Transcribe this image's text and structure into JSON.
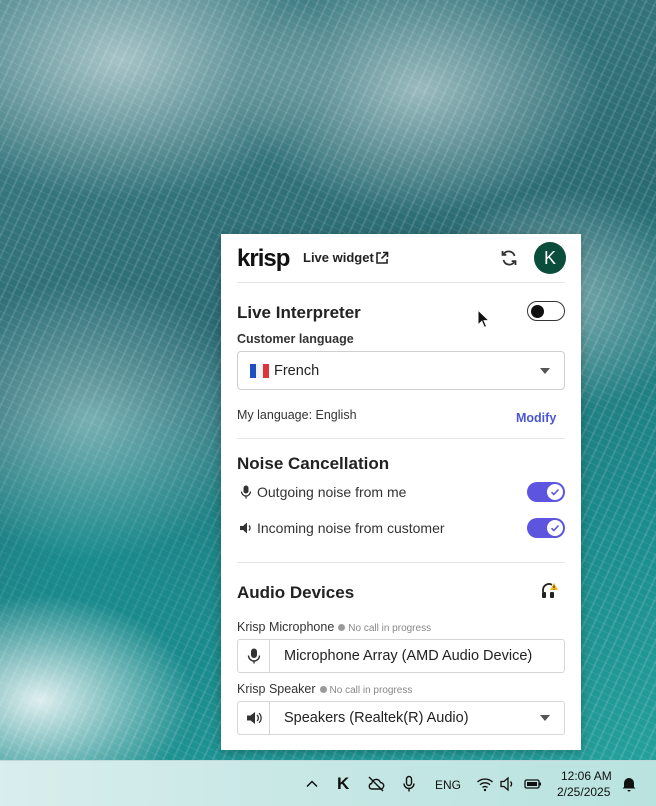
{
  "header": {
    "logo": "krisp",
    "live_widget_label": "Live widget",
    "avatar_initial": "K"
  },
  "interpreter": {
    "title": "Live Interpreter",
    "enabled": false,
    "customer_language_label": "Customer language",
    "customer_language_value": "French",
    "my_language_text": "My language: English",
    "modify_label": "Modify"
  },
  "noise": {
    "title": "Noise Cancellation",
    "outgoing_label": "Outgoing noise from me",
    "outgoing_enabled": true,
    "incoming_label": "Incoming noise from customer",
    "incoming_enabled": true
  },
  "audio": {
    "title": "Audio Devices",
    "mic_label": "Krisp Microphone",
    "mic_status": "No call in progress",
    "mic_device": "Microphone Array (AMD Audio Device)",
    "speaker_label": "Krisp Speaker",
    "speaker_status": "No call in progress",
    "speaker_device": "Speakers (Realtek(R) Audio)"
  },
  "taskbar": {
    "language": "ENG",
    "time": "12:06 AM",
    "date": "2/25/2025",
    "krisp_tray_glyph": "K"
  },
  "colors": {
    "accent": "#5d55e0",
    "link": "#4a56d4",
    "avatar_bg": "#0b4d3b"
  }
}
